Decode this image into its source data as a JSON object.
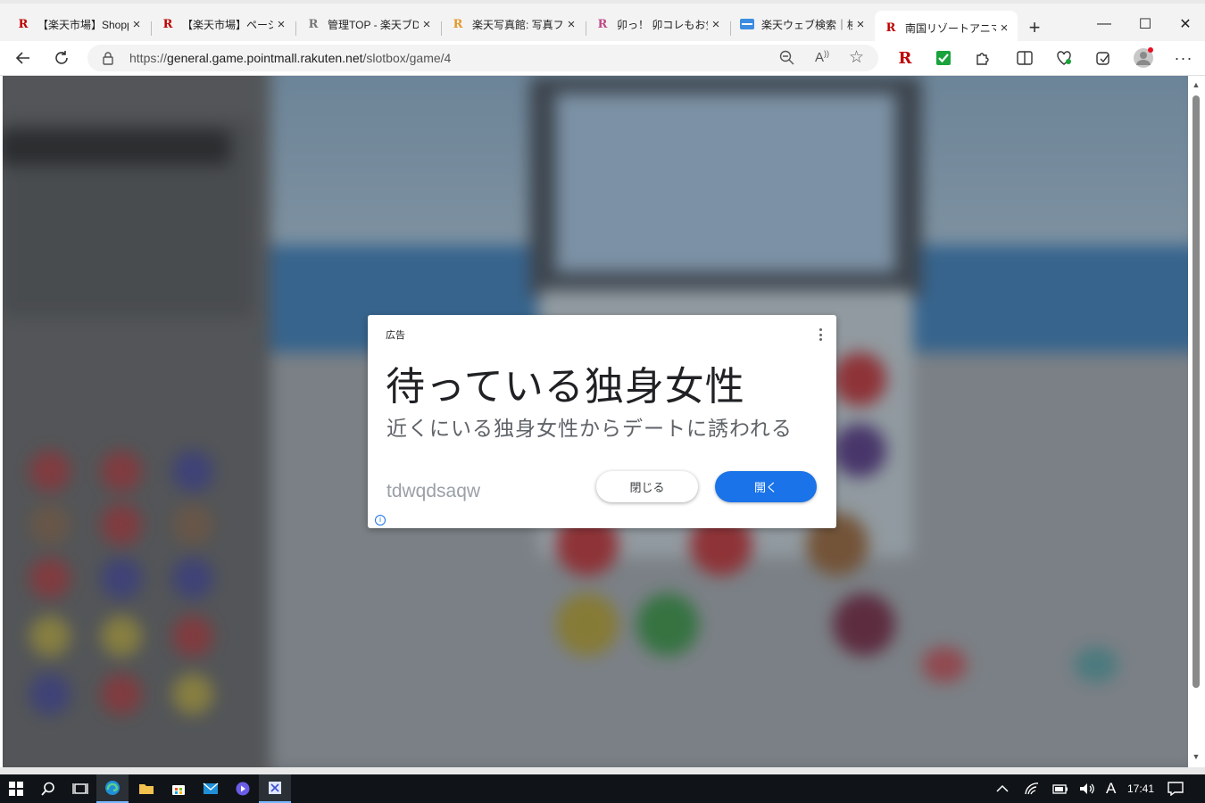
{
  "browser": {
    "tabs": [
      {
        "title": "【楽天市場】Shoppi",
        "favicon": "R",
        "favicon_color": "#bf0000",
        "active": false
      },
      {
        "title": "【楽天市場】ページ間",
        "favicon": "R",
        "favicon_color": "#bf0000",
        "active": false
      },
      {
        "title": "管理TOP - 楽天ブD",
        "favicon": "R",
        "favicon_color": "#777777",
        "active": false
      },
      {
        "title": "楽天写真館: 写真フ",
        "favicon": "R",
        "favicon_color": "#e39a2d",
        "active": false
      },
      {
        "title": "卯っ！ 卯コレもお気",
        "favicon": "R",
        "favicon_color": "#c04a8a",
        "active": false
      },
      {
        "title": "楽天ウェブ検索｜検",
        "favicon": "web",
        "favicon_color": "#3a8de0",
        "active": false
      },
      {
        "title": "南国リゾートアニマル",
        "favicon": "R",
        "favicon_color": "#bf0000",
        "active": true
      }
    ],
    "new_tab_glyph": "+",
    "window_controls": {
      "minimize": "—",
      "maximize": "☐",
      "close": "✕"
    },
    "address": {
      "url_prefix": "https://",
      "url_host": "general.game.pointmall.rakuten.net",
      "url_path": "/slotbox/game/4"
    },
    "toolbar_icons": [
      "back-icon",
      "refresh-icon",
      "lock-icon",
      "zoom-icon",
      "read-aloud-icon",
      "favorite-star-icon",
      "rakuten-extension-icon",
      "check-extension-icon",
      "extensions-icon",
      "split-screen-icon",
      "browser-essentials-icon",
      "collections-icon",
      "profile-avatar-icon",
      "more-menu-icon"
    ]
  },
  "ad": {
    "label": "広告",
    "headline": "待っている独身女性",
    "body": "近くにいる独身女性からデートに誘われる",
    "advertiser": "tdwqdsaqw",
    "close_label": "閉じる",
    "open_label": "開く",
    "info_glyph": "i"
  },
  "taskbar": {
    "time": "17:41",
    "ime": "A"
  },
  "colors": {
    "accent": "#1a73e8",
    "rakuten_red": "#bf0000"
  }
}
